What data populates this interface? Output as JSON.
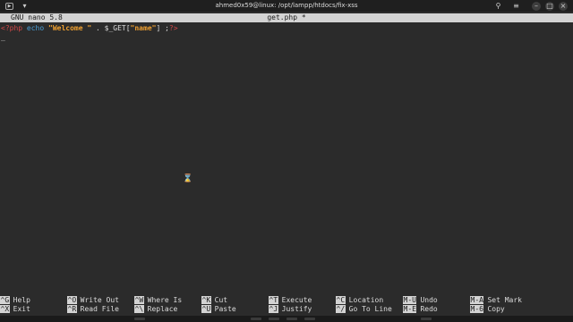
{
  "window": {
    "title": "ahmed0x59@linux: /opt/lampp/htdocs/fix-xss",
    "icons": [
      "terminal-icon",
      "chevron-down-icon",
      "search-icon",
      "menu-icon",
      "minimize-icon",
      "maximize-icon",
      "close-icon"
    ]
  },
  "nano": {
    "version": "GNU nano 5.8",
    "filename": "get.php *"
  },
  "editor": {
    "code": {
      "open_tag": "<?php",
      "keyword": "echo",
      "string1": "\"Welcome \"",
      "op": " . ",
      "var": "$_GET[",
      "string2": "\"name\"",
      "close": "] ;",
      "close_tag": "?>"
    },
    "cursor": "_"
  },
  "shortcuts": [
    {
      "key": "^G",
      "label": "Help"
    },
    {
      "key": "^X",
      "label": "Exit"
    },
    {
      "key": "^O",
      "label": "Write Out"
    },
    {
      "key": "^R",
      "label": "Read File"
    },
    {
      "key": "^W",
      "label": "Where Is"
    },
    {
      "key": "^\\",
      "label": "Replace"
    },
    {
      "key": "^K",
      "label": "Cut"
    },
    {
      "key": "^U",
      "label": "Paste"
    },
    {
      "key": "^T",
      "label": "Execute"
    },
    {
      "key": "^J",
      "label": "Justify"
    },
    {
      "key": "^C",
      "label": "Location"
    },
    {
      "key": "^/",
      "label": "Go To Line"
    },
    {
      "key": "M-U",
      "label": "Undo"
    },
    {
      "key": "M-E",
      "label": "Redo"
    },
    {
      "key": "M-A",
      "label": "Set Mark"
    },
    {
      "key": "M-6",
      "label": "Copy"
    }
  ],
  "colors": {
    "background": "#2b2b2b",
    "titlebar": "#1f1f1f",
    "header_bar": "#d3d3d3",
    "php_tag": "#d24747",
    "keyword": "#4a9fd8",
    "string": "#f0a030"
  }
}
